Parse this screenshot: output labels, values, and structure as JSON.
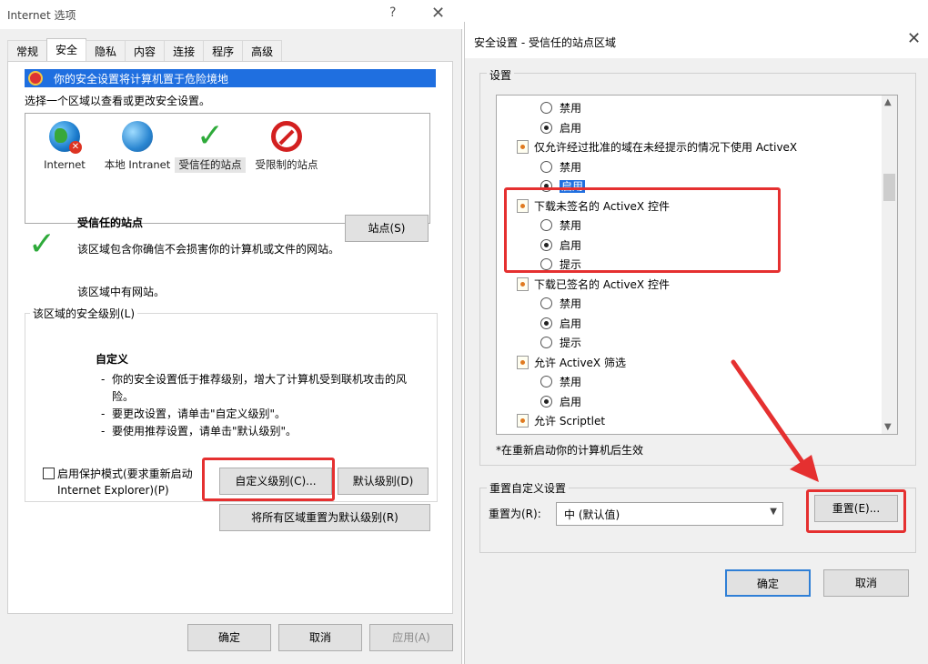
{
  "left_dialog": {
    "title": "Internet 选项",
    "help_glyph": "?",
    "close_glyph": "✕",
    "tabs": [
      "常规",
      "安全",
      "隐私",
      "内容",
      "连接",
      "程序",
      "高级"
    ],
    "active_tab": "安全",
    "banner": "你的安全设置将计算机置于危险境地",
    "zone_prompt": "选择一个区域以查看或更改安全设置。",
    "zones": [
      {
        "label": "Internet",
        "icon": "globe-icon"
      },
      {
        "label": "本地 Intranet",
        "icon": "intranet-icon"
      },
      {
        "label": "受信任的站点",
        "icon": "checkmark-icon"
      },
      {
        "label": "受限制的站点",
        "icon": "restricted-icon"
      }
    ],
    "selected_zone": {
      "title": "受信任的站点",
      "description": "该区域包含你确信不会损害你的计算机或文件的网站。",
      "note": "该区域中有网站。",
      "sites_button": "站点(S)"
    },
    "security_level_group": "该区域的安全级别(L)",
    "level": {
      "title": "自定义",
      "bullets": [
        "你的安全设置低于推荐级别，增大了计算机受到联机攻击的风险。",
        "要更改设置，请单击\"自定义级别\"。",
        "要使用推荐设置，请单击\"默认级别\"。"
      ]
    },
    "protected_mode_label": "启用保护模式(要求重新启动 Internet Explorer)(P)",
    "custom_level_button": "自定义级别(C)...",
    "default_level_button": "默认级别(D)",
    "reset_all_button": "将所有区域重置为默认级别(R)",
    "ok_button": "确定",
    "cancel_button": "取消",
    "apply_button": "应用(A)"
  },
  "right_dialog": {
    "title": "安全设置 - 受信任的站点区域",
    "close_glyph": "✕",
    "settings_label": "设置",
    "tree": [
      {
        "kind": "opt",
        "label": "禁用",
        "checked": false
      },
      {
        "kind": "opt",
        "label": "启用",
        "checked": true
      },
      {
        "kind": "item",
        "label": "仅允许经过批准的域在未经提示的情况下使用 ActiveX"
      },
      {
        "kind": "opt",
        "label": "禁用",
        "checked": false
      },
      {
        "kind": "opt",
        "label": "启用",
        "checked": true,
        "highlighted": true
      },
      {
        "kind": "item",
        "label": "下载未签名的 ActiveX 控件"
      },
      {
        "kind": "opt",
        "label": "禁用",
        "checked": false
      },
      {
        "kind": "opt",
        "label": "启用",
        "checked": true
      },
      {
        "kind": "opt",
        "label": "提示",
        "checked": false
      },
      {
        "kind": "item",
        "label": "下载已签名的 ActiveX 控件"
      },
      {
        "kind": "opt",
        "label": "禁用",
        "checked": false
      },
      {
        "kind": "opt",
        "label": "启用",
        "checked": true
      },
      {
        "kind": "opt",
        "label": "提示",
        "checked": false
      },
      {
        "kind": "item",
        "label": "允许 ActiveX 筛选"
      },
      {
        "kind": "opt",
        "label": "禁用",
        "checked": false
      },
      {
        "kind": "opt",
        "label": "启用",
        "checked": true
      },
      {
        "kind": "item",
        "label": "允许 Scriptlet"
      }
    ],
    "restart_note": "*在重新启动你的计算机后生效",
    "reset_group_label": "重置自定义设置",
    "reset_to_label": "重置为(R):",
    "reset_to_value": "中 (默认值)",
    "reset_button": "重置(E)...",
    "ok_button": "确定",
    "cancel_button": "取消"
  },
  "annotation_color": "#e53030"
}
